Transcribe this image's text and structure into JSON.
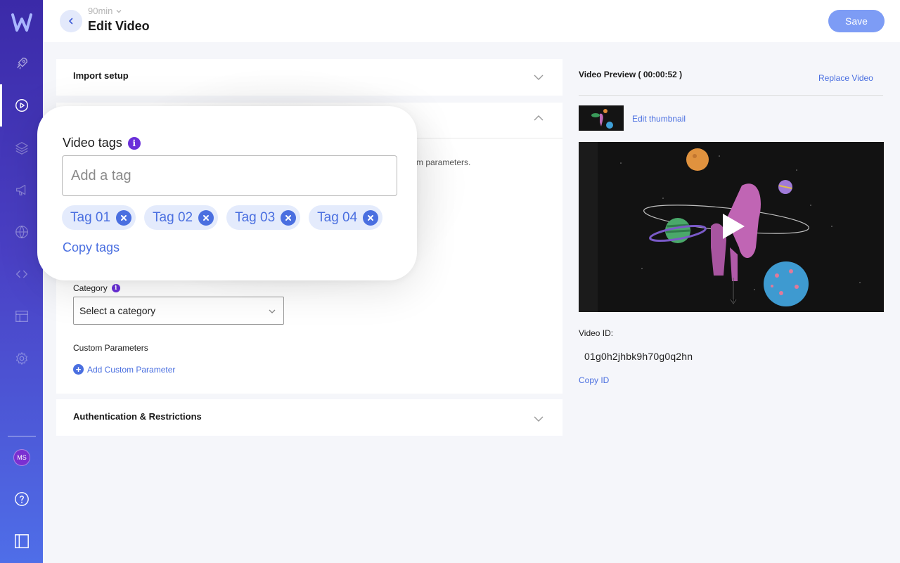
{
  "header": {
    "breadcrumb": "90min",
    "title": "Edit Video",
    "save_label": "Save"
  },
  "sidebar": {
    "items": [
      {
        "icon": "rocket-icon"
      },
      {
        "icon": "play-circle-icon",
        "active": true
      },
      {
        "icon": "layers-icon"
      },
      {
        "icon": "megaphone-icon"
      },
      {
        "icon": "globe-icon"
      },
      {
        "icon": "code-icon"
      },
      {
        "icon": "layout-icon"
      },
      {
        "icon": "gear-icon"
      }
    ],
    "avatar_initials": "MS",
    "bottom": [
      {
        "icon": "help-icon"
      },
      {
        "icon": "sidebar-toggle-icon"
      }
    ]
  },
  "main": {
    "import_setup_title": "Import setup",
    "hint_text": "m parameters.",
    "category_label": "Category",
    "category_placeholder": "Select a category",
    "custom_params_label": "Custom Parameters",
    "add_custom_param_label": "Add Custom Parameter",
    "auth_title": "Authentication & Restrictions"
  },
  "tags_card": {
    "label": "Video tags",
    "input_placeholder": "Add a tag",
    "tags": [
      "Tag 01",
      "Tag 02",
      "Tag 03",
      "Tag 04"
    ],
    "copy_label": "Copy tags"
  },
  "preview": {
    "title": "Video Preview ( 00:00:52 )",
    "replace_label": "Replace Video",
    "edit_thumbnail_label": "Edit thumbnail",
    "video_id_label": "Video ID:",
    "video_id_value": "01g0h2jhbk9h70g0q2hn",
    "copy_id_label": "Copy ID"
  },
  "colors": {
    "accent": "#4a6fe0",
    "save_button": "#7d9cf5",
    "info": "#6a2fd9",
    "sidebar_top": "#3b2aa8",
    "sidebar_bottom": "#4f6ee8"
  }
}
